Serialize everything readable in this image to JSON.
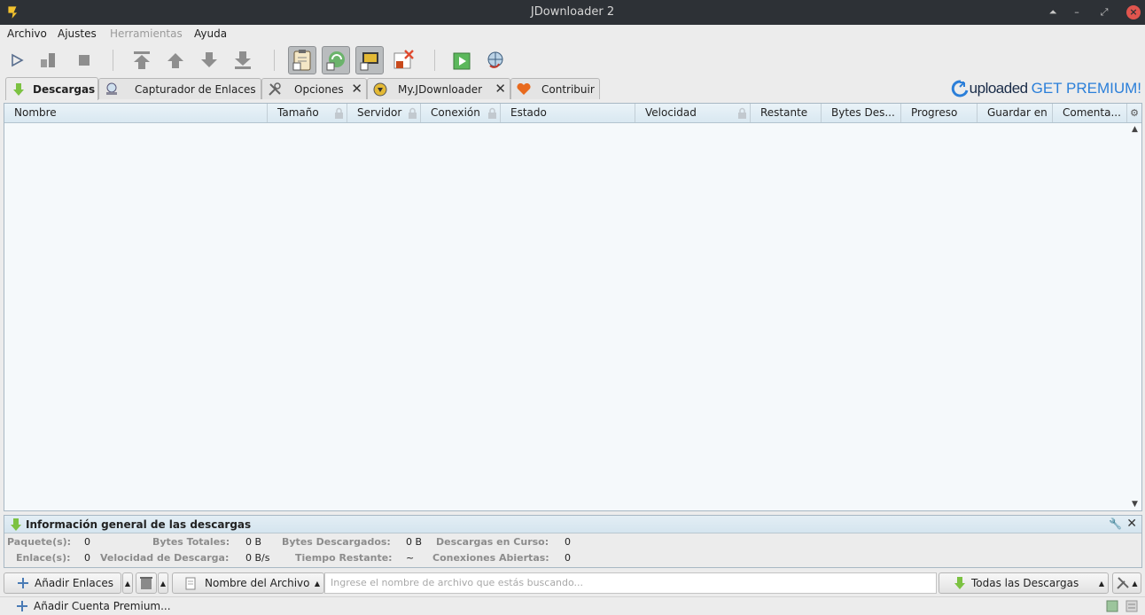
{
  "window": {
    "title": "JDownloader 2"
  },
  "menu": [
    "Archivo",
    "Ajustes",
    "Herramientas",
    "Ayuda"
  ],
  "tabs": [
    {
      "label": "Descargas",
      "icon": "download-arrow-icon"
    },
    {
      "label": "Capturador de Enlaces",
      "icon": "link-grabber-icon"
    },
    {
      "label": "Opciones",
      "icon": "settings-tools-icon"
    },
    {
      "label": "My.JDownloader",
      "icon": "myjd-icon"
    },
    {
      "label": "Contribuir",
      "icon": "heart-icon"
    }
  ],
  "premium_banner": {
    "brand": "uploaded",
    "cta": "GET PREMIUM!"
  },
  "table": {
    "columns": [
      "Nombre",
      "Tamaño",
      "Servidor",
      "Conexión",
      "Estado",
      "Velocidad",
      "Restante",
      "Bytes Des...",
      "Progreso",
      "Guardar en",
      "Comenta..."
    ],
    "rows": []
  },
  "overview": {
    "title": "Información general de las descargas",
    "row1": [
      {
        "label": "Paquete(s):",
        "value": "0"
      },
      {
        "label": "Bytes Totales:",
        "value": "0 B"
      },
      {
        "label": "Bytes Descargados:",
        "value": "0 B"
      },
      {
        "label": "Descargas en Curso:",
        "value": "0"
      }
    ],
    "row2": [
      {
        "label": "Enlace(s):",
        "value": "0"
      },
      {
        "label": "Velocidad de Descarga:",
        "value": "0 B/s"
      },
      {
        "label": "Tiempo Restante:",
        "value": "~"
      },
      {
        "label": "Conexiones Abiertas:",
        "value": "0"
      }
    ]
  },
  "bottom": {
    "add_links": "Añadir Enlaces",
    "sort_field": "Nombre del Archivo",
    "search_placeholder": "Ingrese el nombre de archivo que estás buscando...",
    "view_filter": "Todas las Descargas"
  },
  "status": {
    "add_premium": "Añadir Cuenta Premium..."
  },
  "colors": {
    "accent": "#2b7fd9",
    "title_bar": "#2d3136",
    "close_button": "#e0554e",
    "green_arrow": "#7cc242"
  }
}
